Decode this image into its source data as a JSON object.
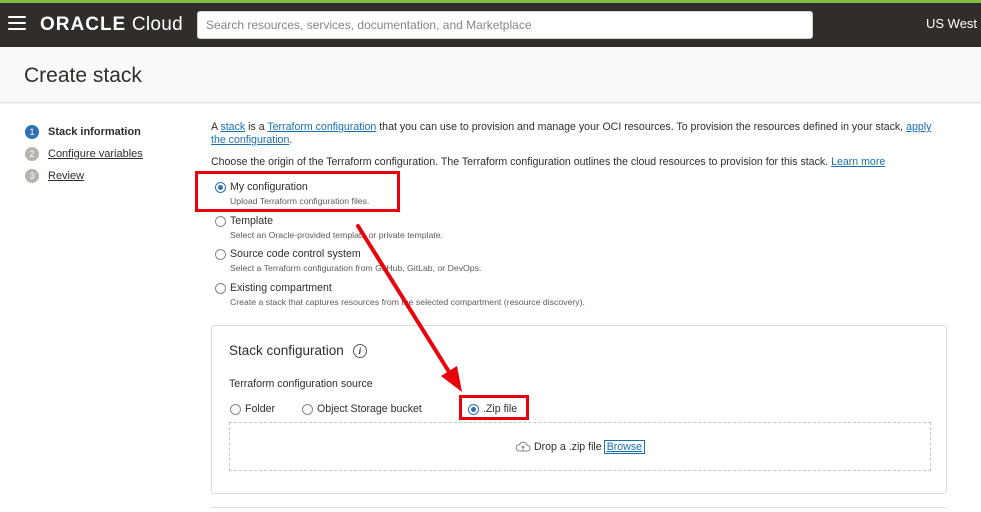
{
  "header": {
    "brand_bold": "ORACLE",
    "brand_light": " Cloud",
    "search_placeholder": "Search resources, services, documentation, and Marketplace",
    "region": "US West ("
  },
  "page": {
    "title": "Create stack"
  },
  "steps": [
    {
      "num": "1",
      "label": "Stack information"
    },
    {
      "num": "2",
      "label": "Configure variables"
    },
    {
      "num": "3",
      "label": "Review"
    }
  ],
  "intro": {
    "t1": "A ",
    "stack_link": "stack",
    "t2": " is a ",
    "terraform_link": "Terraform configuration",
    "t3": " that you can use to provision and manage your OCI resources. To provision the resources defined in your stack, ",
    "apply_link": "apply the configuration",
    "t4": "."
  },
  "choose": {
    "text": "Choose the origin of the Terraform configuration. The Terraform configuration outlines the cloud resources to provision for this stack. ",
    "learn_more": "Learn more"
  },
  "origin_options": [
    {
      "label": "My configuration",
      "desc": "Upload Terraform configuration files.",
      "checked": true
    },
    {
      "label": "Template",
      "desc": "Select an Oracle-provided template or private template.",
      "checked": false
    },
    {
      "label": "Source code control system",
      "desc": "Select a Terraform configuration from GitHub, GitLab, or DevOps.",
      "checked": false
    },
    {
      "label": "Existing compartment",
      "desc": "Create a stack that captures resources from the selected compartment (resource discovery).",
      "checked": false
    }
  ],
  "stack_config": {
    "title": "Stack configuration",
    "source_label": "Terraform configuration source",
    "sources": [
      {
        "label": "Folder",
        "checked": false
      },
      {
        "label": "Object Storage bucket",
        "checked": false
      },
      {
        "label": ".Zip file",
        "checked": true
      }
    ],
    "drop_text": "Drop a .zip file",
    "browse": "Browse"
  },
  "colors": {
    "topbar": "#312d2a",
    "accent": "#2f6fb5",
    "highlight": "#e8000b",
    "link": "#1a6fb0"
  }
}
